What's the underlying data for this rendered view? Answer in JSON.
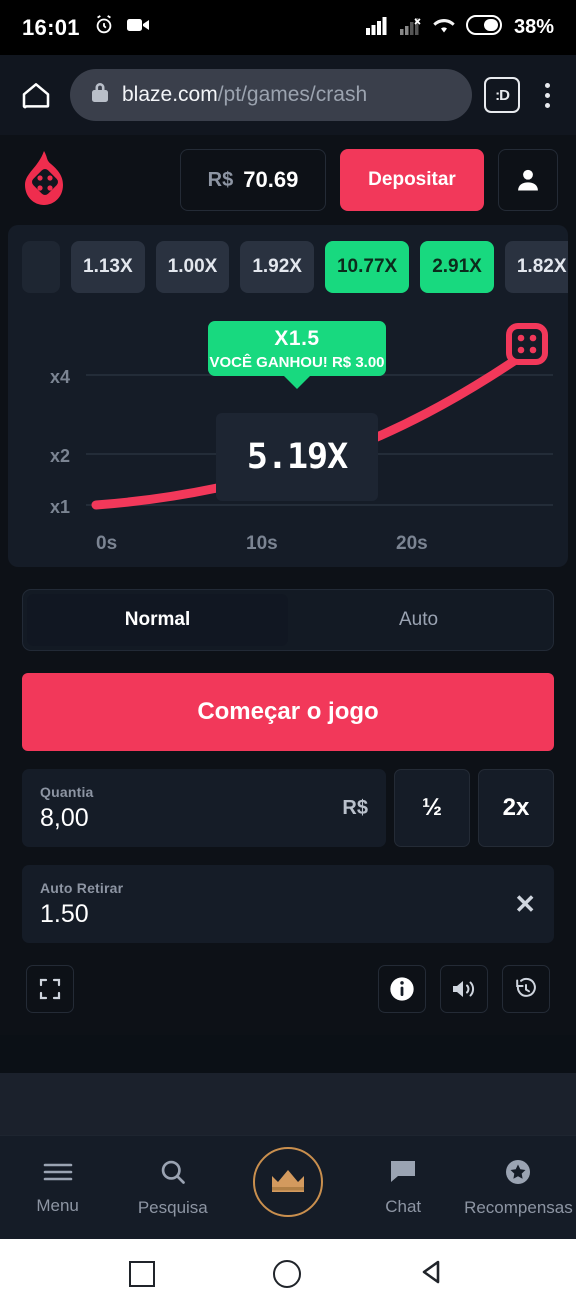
{
  "status_bar": {
    "time": "16:01",
    "battery_percent": "38%",
    "icons": [
      "alarm-icon",
      "video-record-icon",
      "signal-bars-icon",
      "signal-bars-weak-icon",
      "wifi-icon",
      "battery-icon"
    ]
  },
  "browser": {
    "home_icon": "home-icon",
    "lock_icon": "lock-icon",
    "url_domain": "blaze.com",
    "url_path": "/pt/games/crash",
    "tab_count_label": ":D",
    "menu_icon": "kebab-menu-icon"
  },
  "app_header": {
    "logo_icon": "blaze-flame-dice-logo",
    "currency": "R$",
    "balance": "70.69",
    "deposit_label": "Depositar",
    "profile_icon": "user-avatar-icon"
  },
  "history": {
    "items": [
      {
        "label": "",
        "win": false,
        "clipped": true
      },
      {
        "label": "1.13X",
        "win": false
      },
      {
        "label": "1.00X",
        "win": false
      },
      {
        "label": "1.92X",
        "win": false
      },
      {
        "label": "10.77X",
        "win": true
      },
      {
        "label": "2.91X",
        "win": true
      },
      {
        "label": "1.82X",
        "win": false
      }
    ],
    "stats_icon": "bar-chart-icon"
  },
  "chart_data": {
    "type": "line",
    "title": "",
    "xlabel": "",
    "ylabel": "",
    "x_ticks": [
      "0s",
      "10s",
      "20s"
    ],
    "y_ticks": [
      "x1",
      "x2",
      "x4"
    ],
    "ylim": [
      1,
      5.2
    ],
    "xlim": [
      0,
      24
    ],
    "grid": true,
    "line_color": "#f2385a",
    "series": [
      {
        "name": "multiplier",
        "x": [
          0,
          3,
          6,
          9,
          12,
          15,
          18,
          21,
          23
        ],
        "y": [
          1.0,
          1.08,
          1.22,
          1.45,
          1.82,
          2.35,
          3.05,
          4.05,
          4.85
        ]
      }
    ],
    "end_marker_icon": "dice-marker-icon",
    "current_multiplier": "5.19X",
    "win_badge": {
      "multiplier": "X1.5",
      "message": "VOCÊ GANHOU! R$ 3.00",
      "color": "#18d97f"
    }
  },
  "mode_tabs": {
    "items": [
      {
        "label": "Normal",
        "active": true
      },
      {
        "label": "Auto",
        "active": false
      }
    ]
  },
  "start_button": {
    "label": "Começar o jogo",
    "color": "#f2385a"
  },
  "bet_form": {
    "amount": {
      "label": "Quantia",
      "value": "8,00",
      "currency": "R$"
    },
    "half_label": "½",
    "double_label": "2x",
    "auto_cashout": {
      "label": "Auto Retirar",
      "value": "1.50",
      "clear_icon": "close-icon"
    }
  },
  "game_toolbar": {
    "fullscreen_icon": "fullscreen-icon",
    "info_icon": "info-icon",
    "volume_icon": "volume-icon",
    "history_icon": "history-clock-icon"
  },
  "bottom_nav": {
    "items": [
      {
        "label": "Menu",
        "icon": "hamburger-menu-icon"
      },
      {
        "label": "Pesquisa",
        "icon": "search-icon"
      },
      {
        "label": "",
        "icon": "crown-icon"
      },
      {
        "label": "Chat",
        "icon": "chat-bubble-icon"
      },
      {
        "label": "Recompensas",
        "icon": "star-badge-icon"
      }
    ]
  },
  "android_nav": {
    "recents_icon": "square-recents-icon",
    "home_icon": "circle-home-icon",
    "back_icon": "triangle-back-icon"
  }
}
